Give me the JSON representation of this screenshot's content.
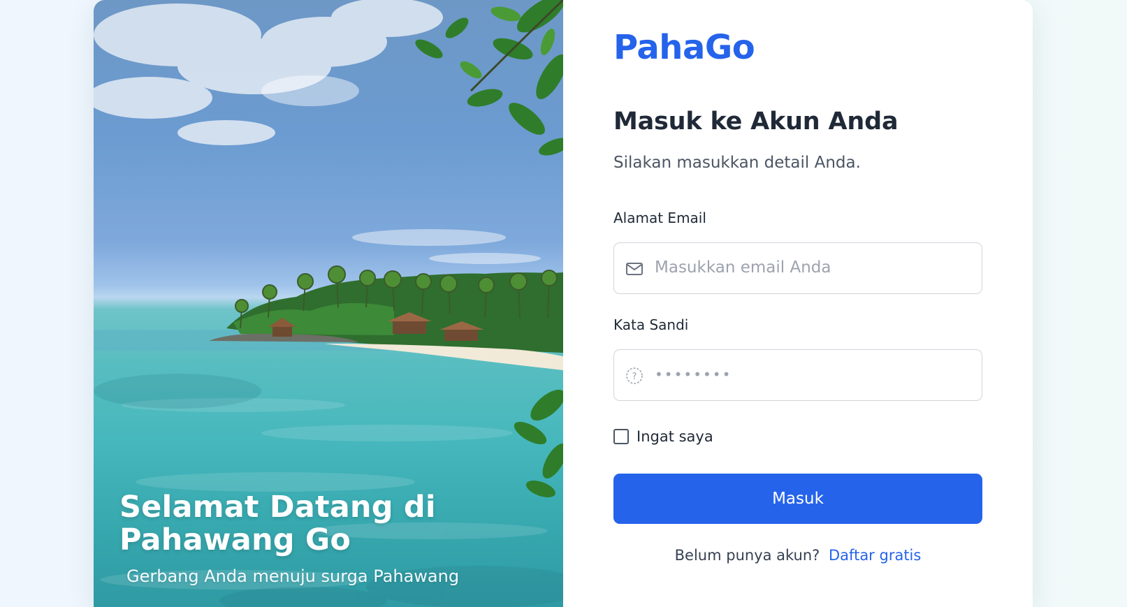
{
  "brand": {
    "name": "PahaGo",
    "accent_color": "#2563eb"
  },
  "hero": {
    "title_line1": "Selamat Datang di",
    "title_line2": "Pahawang Go",
    "subtitle": "Gerbang Anda menuju surga Pahawang"
  },
  "form": {
    "heading": "Masuk ke Akun Anda",
    "subheading": "Silakan masukkan detail Anda.",
    "email": {
      "label": "Alamat Email",
      "placeholder": "Masukkan email Anda",
      "value": "",
      "icon": "envelope-icon"
    },
    "password": {
      "label": "Kata Sandi",
      "value": "••••••••",
      "icon": "question-circle-icon"
    },
    "remember": {
      "label": "Ingat saya",
      "checked": false
    },
    "submit_label": "Masuk",
    "signup": {
      "prompt": "Belum punya akun?",
      "link_label": "Daftar gratis"
    }
  }
}
